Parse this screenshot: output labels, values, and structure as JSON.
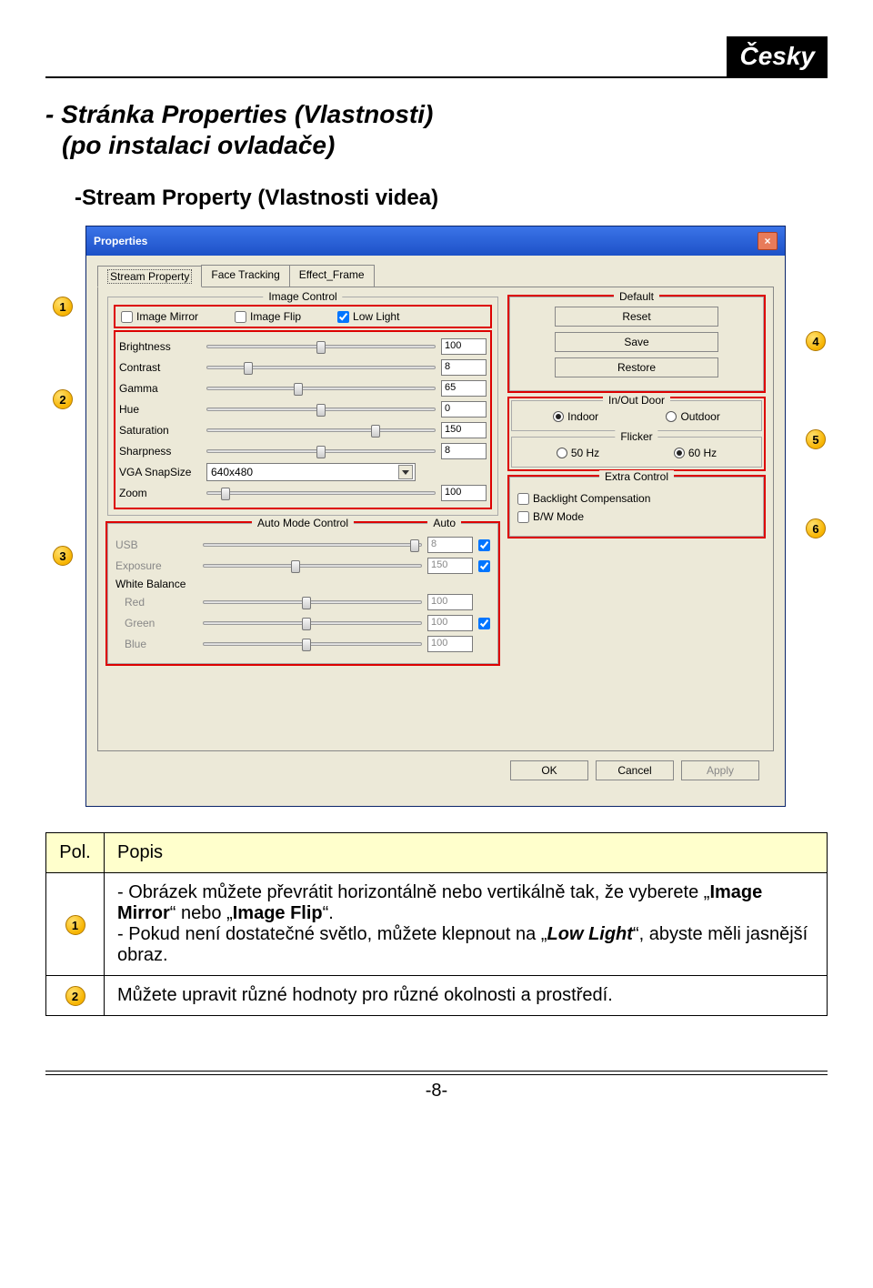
{
  "lang_badge": "Česky",
  "heading_line1": "- Stránka Properties (Vlastnosti)",
  "heading_line2": "(po instalaci ovladače)",
  "heading2": "-Stream Property (Vlastnosti videa)",
  "dialog": {
    "title": "Properties",
    "tabs": [
      "Stream Property",
      "Face Tracking",
      "Effect_Frame"
    ],
    "image_control": {
      "legend": "Image Control",
      "mirror": "Image Mirror",
      "flip": "Image Flip",
      "lowlight": "Low Light",
      "mirror_checked": false,
      "flip_checked": false,
      "lowlight_checked": true
    },
    "sliders": {
      "brightness": {
        "label": "Brightness",
        "value": "100",
        "pos": 48
      },
      "contrast": {
        "label": "Contrast",
        "value": "8",
        "pos": 16
      },
      "gamma": {
        "label": "Gamma",
        "value": "65",
        "pos": 38
      },
      "hue": {
        "label": "Hue",
        "value": "0",
        "pos": 48
      },
      "saturation": {
        "label": "Saturation",
        "value": "150",
        "pos": 72
      },
      "sharpness": {
        "label": "Sharpness",
        "value": "8",
        "pos": 48
      },
      "zoom": {
        "label": "Zoom",
        "value": "100",
        "pos": 6
      }
    },
    "snapsize": {
      "label": "VGA SnapSize",
      "value": "640x480"
    },
    "automode": {
      "legend": "Auto Mode Control",
      "auto_label": "Auto",
      "usb": {
        "label": "USB",
        "value": "8",
        "pos": 95,
        "auto": true,
        "disabled": true
      },
      "exposure": {
        "label": "Exposure",
        "value": "150",
        "pos": 40,
        "auto": true,
        "disabled": true
      },
      "wb_label": "White Balance",
      "red": {
        "label": "Red",
        "value": "100",
        "pos": 45,
        "disabled": true
      },
      "green": {
        "label": "Green",
        "value": "100",
        "pos": 45,
        "auto": true,
        "disabled": true
      },
      "blue": {
        "label": "Blue",
        "value": "100",
        "pos": 45,
        "disabled": true
      }
    },
    "default_group": {
      "legend": "Default",
      "reset": "Reset",
      "save": "Save",
      "restore": "Restore"
    },
    "inout": {
      "legend": "In/Out Door",
      "indoor": "Indoor",
      "outdoor": "Outdoor",
      "indoor_sel": true
    },
    "flicker": {
      "legend": "Flicker",
      "hz50": "50 Hz",
      "hz60": "60 Hz",
      "hz60_sel": true
    },
    "extra": {
      "legend": "Extra Control",
      "backlight": "Backlight Compensation",
      "bw": "B/W Mode"
    },
    "buttons": {
      "ok": "OK",
      "cancel": "Cancel",
      "apply": "Apply"
    }
  },
  "table": {
    "header_pol": "Pol.",
    "header_popis": "Popis",
    "row1_a": "- Obrázek můžete převrátit horizontálně nebo vertikálně tak, že vyberete „",
    "row1_b": "Image Mirror",
    "row1_c": "“ nebo „",
    "row1_d": "Image Flip",
    "row1_e": "“.",
    "row1_f": "- Pokud není dostatečné světlo, můžete klepnout na „",
    "row1_g": "Low Light",
    "row1_h": "“, abyste měli jasnější obraz.",
    "row2": "Můžete upravit různé hodnoty pro různé okolnosti a prostředí."
  },
  "page_number": "-8-"
}
